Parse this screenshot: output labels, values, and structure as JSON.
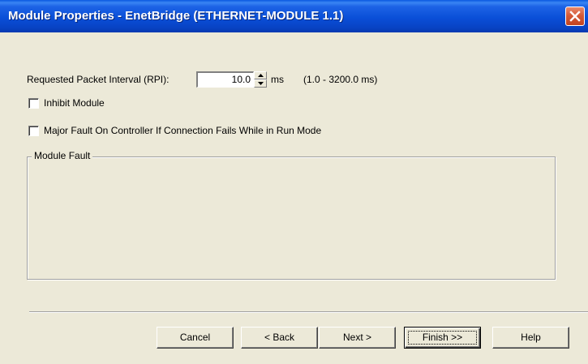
{
  "window": {
    "title": "Module Properties  - EnetBridge (ETHERNET-MODULE 1.1)"
  },
  "rpi": {
    "label": "Requested Packet Interval (RPI):",
    "value": "10.0",
    "unit": "ms",
    "range": "(1.0 - 3200.0 ms)"
  },
  "options": {
    "inhibit_label": "Inhibit Module",
    "inhibit_checked": false,
    "major_fault_label": "Major Fault On Controller If Connection Fails While in Run Mode",
    "major_fault_checked": false
  },
  "module_fault": {
    "legend": "Module Fault",
    "text": ""
  },
  "buttons": {
    "cancel": "Cancel",
    "back": "< Back",
    "next": "Next >",
    "finish": "Finish >>",
    "help": "Help"
  },
  "icons": {
    "close": "close-icon",
    "spin_up": "up-arrow-icon",
    "spin_down": "down-arrow-icon"
  },
  "colors": {
    "title_bar": "#0a4fd8",
    "close_button": "#d55a38",
    "dialog_background": "#ece9d8"
  }
}
